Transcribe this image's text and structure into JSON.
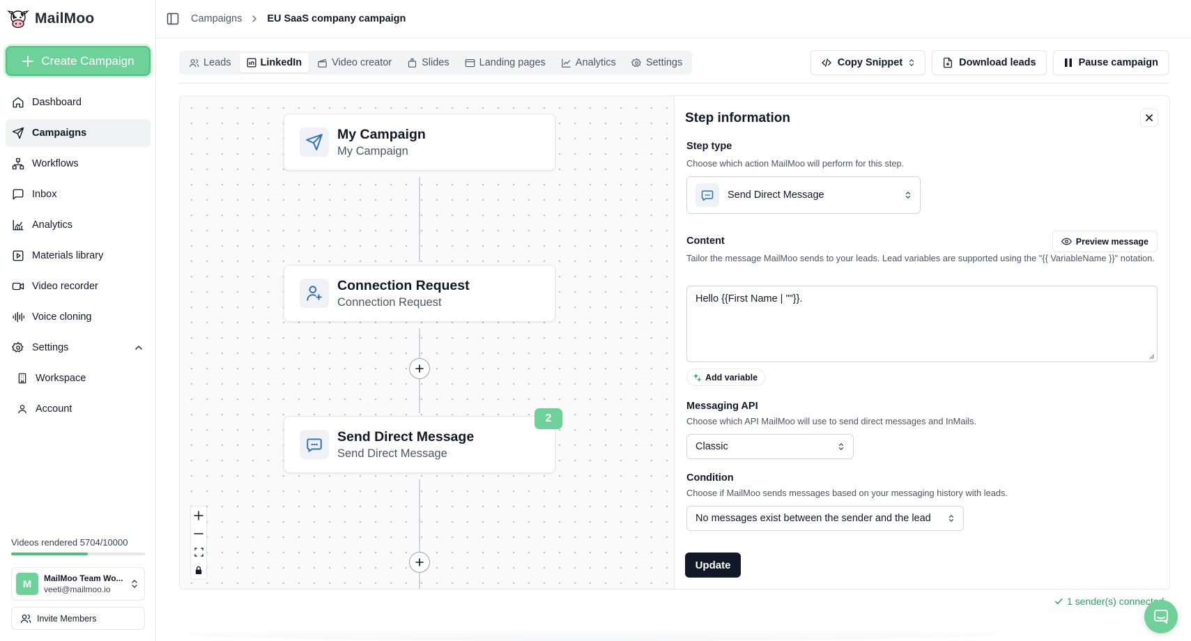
{
  "brand": {
    "name": "MailMoo"
  },
  "sidebar": {
    "create_label": "Create Campaign",
    "items": [
      {
        "label": "Dashboard",
        "icon": "home-icon"
      },
      {
        "label": "Campaigns",
        "icon": "send-icon",
        "active": true
      },
      {
        "label": "Workflows",
        "icon": "workflow-icon"
      },
      {
        "label": "Inbox",
        "icon": "message-square-icon"
      },
      {
        "label": "Analytics",
        "icon": "chart-icon"
      },
      {
        "label": "Materials library",
        "icon": "play-square-icon"
      },
      {
        "label": "Video recorder",
        "icon": "video-icon"
      },
      {
        "label": "Voice cloning",
        "icon": "audio-lines-icon"
      },
      {
        "label": "Settings",
        "icon": "gear-icon",
        "expanded": true
      }
    ],
    "sub_items": [
      {
        "label": "Workspace",
        "icon": "building-icon"
      },
      {
        "label": "Account",
        "icon": "user-icon"
      }
    ],
    "videos_rendered": {
      "label": "Videos rendered 5704/10000",
      "used": 5704,
      "total": 10000
    },
    "team": {
      "initial": "M",
      "name": "MailMoo Team Wo...",
      "email": "veeti@mailmoo.io"
    },
    "invite_label": "Invite Members"
  },
  "breadcrumb": {
    "parent": "Campaigns",
    "current": "EU SaaS company campaign"
  },
  "tabs": [
    {
      "label": "Leads",
      "icon": "users-icon"
    },
    {
      "label": "LinkedIn",
      "icon": "linkedin-icon",
      "active": true
    },
    {
      "label": "Video creator",
      "icon": "clapperboard-icon"
    },
    {
      "label": "Slides",
      "icon": "slides-icon"
    },
    {
      "label": "Landing pages",
      "icon": "browser-icon"
    },
    {
      "label": "Analytics",
      "icon": "line-chart-icon"
    },
    {
      "label": "Settings",
      "icon": "gear-icon"
    }
  ],
  "actions": {
    "copy_snippet": "Copy Snippet",
    "download_leads": "Download leads",
    "pause_campaign": "Pause campaign"
  },
  "flow": {
    "nodes": [
      {
        "title": "My Campaign",
        "subtitle": "My Campaign",
        "icon": "send-icon"
      },
      {
        "title": "Connection Request",
        "subtitle": "Connection Request",
        "icon": "user-plus-icon"
      },
      {
        "title": "Send Direct Message",
        "subtitle": "Send Direct Message",
        "icon": "message-bot-icon",
        "badge": "2"
      }
    ]
  },
  "step_panel": {
    "title": "Step information",
    "step_type": {
      "label": "Step type",
      "help": "Choose which action MailMoo will perform for this step.",
      "value": "Send Direct Message"
    },
    "content": {
      "label": "Content",
      "preview_label": "Preview message",
      "help": "Tailor the message MailMoo sends to your leads. Lead variables are supported using the \"{{ VariableName }}\" notation.",
      "value": "Hello {{First Name | \"\"}}.",
      "add_variable_label": "Add variable"
    },
    "messaging_api": {
      "label": "Messaging API",
      "help": "Choose which API MailMoo will use to send direct messages and InMails.",
      "value": "Classic"
    },
    "condition": {
      "label": "Condition",
      "help": "Choose if MailMoo sends messages based on your messaging history with leads.",
      "value": "No messages exist between the sender and the lead"
    },
    "update_label": "Update"
  },
  "status": {
    "senders_connected": "1 sender(s) connected"
  },
  "colors": {
    "brand_green": "#6fd19a",
    "dark": "#111827",
    "success_text": "#22a35a"
  }
}
